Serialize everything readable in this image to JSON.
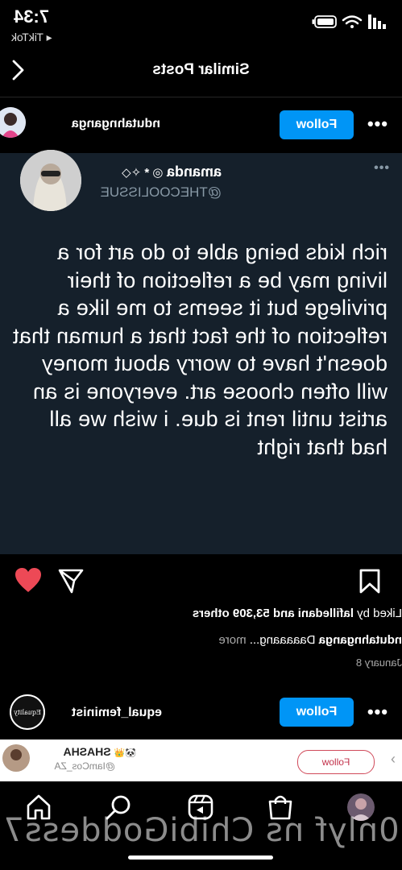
{
  "status_bar": {
    "time": "7:34",
    "back_app": "◂ TikTok"
  },
  "header": {
    "title": "Similar Posts"
  },
  "post1": {
    "username": "ndutahnganga",
    "follow_label": "Follow",
    "more_label": "•••",
    "tweet": {
      "display_name": "amanda",
      "name_badges": "◎ * ✧◇",
      "handle": "@THECOOLISSUE",
      "more_label": "•••",
      "text": "rich kids being able to do art for a living may be a reflection of their privilege but it seems to me like a reflection of the fact that a human that doesn't have to worry about money will often choose art. everyone is an artist until rent is due. i wish we all had that right"
    },
    "liked_by_prefix": "Liked by ",
    "liked_by_user": "lafilledani",
    "liked_by_suffix": " and 53,309 others",
    "caption_user": "ndutahnganga",
    "caption_text": " Daaaaang...",
    "caption_more": " more",
    "date": "January 8"
  },
  "post2": {
    "username": "equal_feminist",
    "follow_label": "Follow",
    "more_label": "•••",
    "avatar_logo_text": "Equality"
  },
  "ad_banner": {
    "name": "SHASHA",
    "handle": "@IamCos_ZA",
    "follow_label": "Follow",
    "chevron": "›"
  },
  "watermark": "0nlyf ns ChibiGoddess7",
  "colors": {
    "follow_blue": "#0095f6",
    "like_red": "#ed4956",
    "tweet_bg": "#15202b",
    "handle_gray": "#8899a6"
  }
}
